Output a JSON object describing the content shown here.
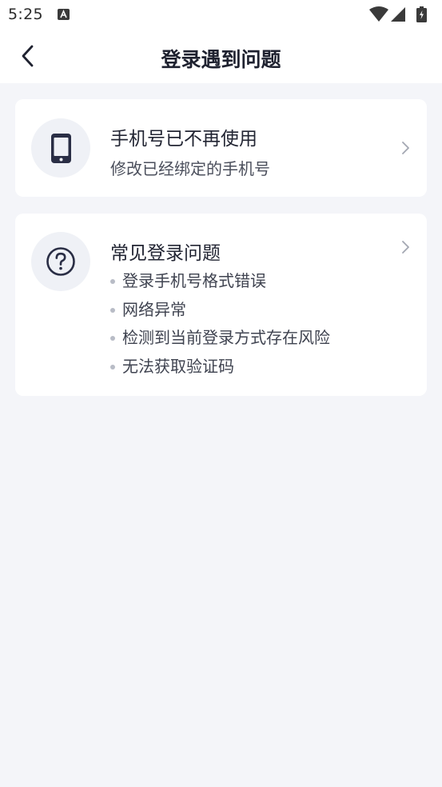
{
  "status_bar": {
    "time": "5:25"
  },
  "header": {
    "title": "登录遇到问题"
  },
  "phone_card": {
    "title": "手机号已不再使用",
    "subtitle": "修改已经绑定的手机号",
    "icon": "phone-icon"
  },
  "faq_card": {
    "title": "常见登录问题",
    "icon": "question-icon",
    "items": [
      "登录手机号格式错误",
      "网络异常",
      "检测到当前登录方式存在风险",
      "无法获取验证码"
    ]
  },
  "colors": {
    "background": "#f4f5f9",
    "card": "#ffffff",
    "icon_circle": "#eff1f6",
    "icon_dark": "#2a2e45",
    "text_primary": "#222533",
    "text_secondary": "#4b4f5c"
  }
}
